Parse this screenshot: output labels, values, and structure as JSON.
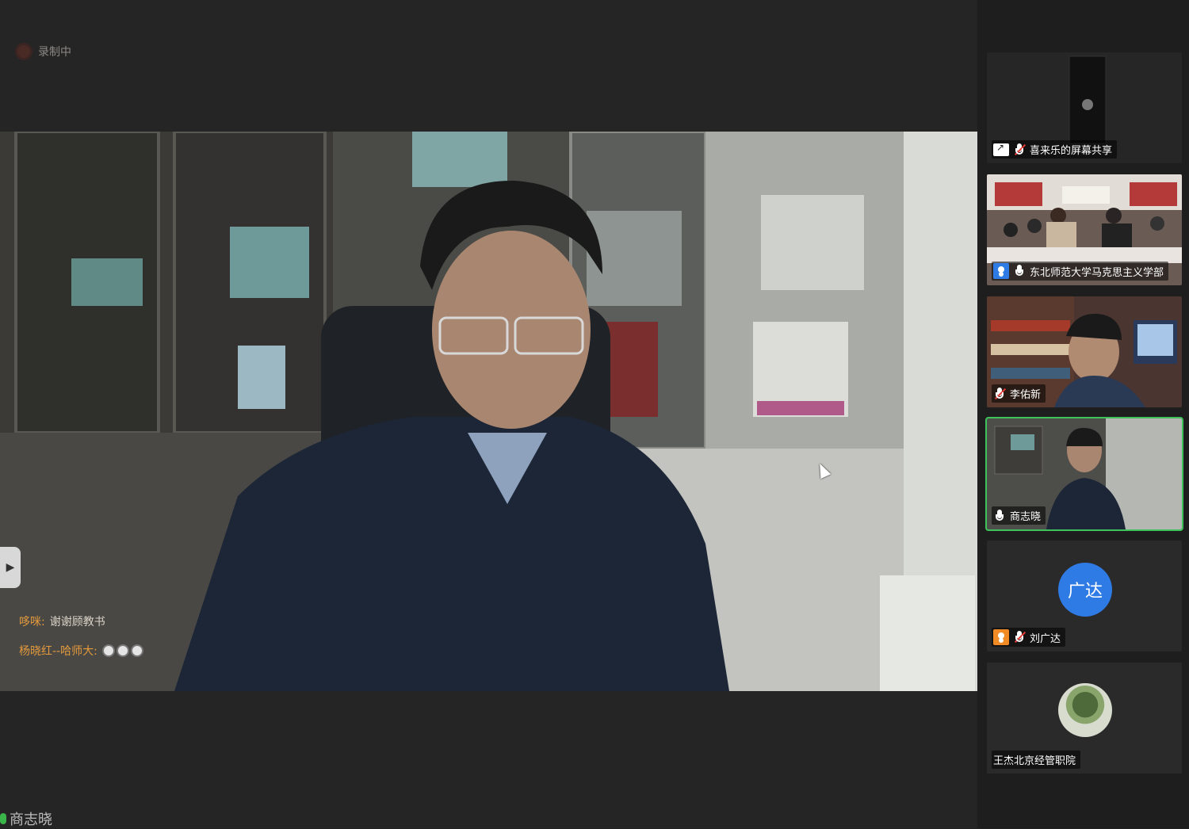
{
  "recording": {
    "label": "录制中"
  },
  "chat": [
    {
      "sender": "哆咪:",
      "message": "谢谢顾教书"
    },
    {
      "sender": "杨晓红--哈师大:",
      "message": ""
    }
  ],
  "active_speaker": {
    "name": "商志晓"
  },
  "participants": [
    {
      "name": "喜来乐的屏幕共享",
      "mic": "muted",
      "badge": "share"
    },
    {
      "name": "东北师范大学马克思主义学部",
      "mic": "on",
      "badge": "user-blue"
    },
    {
      "name": "李佑新",
      "mic": "muted",
      "badge": "none"
    },
    {
      "name": "商志晓",
      "mic": "on",
      "badge": "none",
      "active": true
    },
    {
      "name": "刘广达",
      "mic": "muted",
      "badge": "user-orange",
      "avatar_text": "广达"
    },
    {
      "name": "王杰北京经管职院",
      "mic": "none",
      "badge": "none"
    }
  ],
  "colors": {
    "accent_green": "#3ec35a",
    "avatar_blue": "#2f7be6",
    "chat_sender": "#e39a3d"
  }
}
